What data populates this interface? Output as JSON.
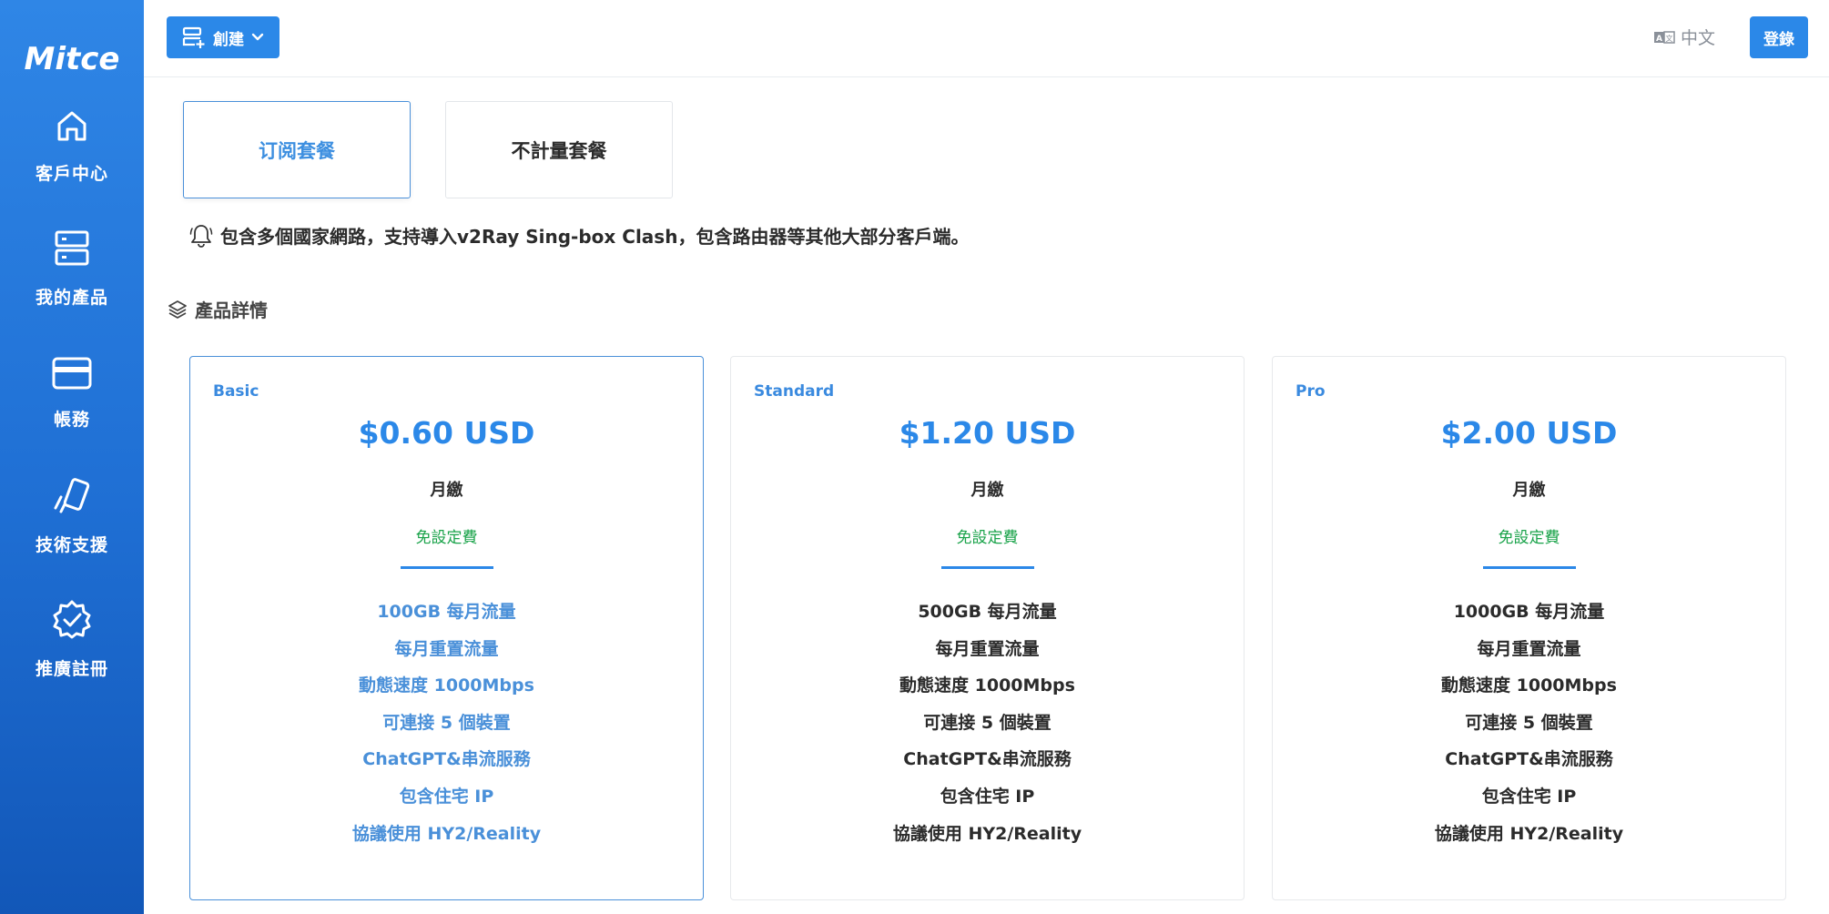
{
  "brand": {
    "logo_text": "Mitce"
  },
  "sidebar": {
    "items": [
      {
        "label": "客戶中心",
        "icon": "home-icon"
      },
      {
        "label": "我的產品",
        "icon": "server-icon"
      },
      {
        "label": "帳務",
        "icon": "credit-card-icon"
      },
      {
        "label": "技術支援",
        "icon": "support-card-icon"
      },
      {
        "label": "推廣註冊",
        "icon": "badge-check-icon"
      }
    ]
  },
  "header": {
    "create_label": "創建",
    "language_label": "中文",
    "login_label": "登錄"
  },
  "tabs": [
    {
      "label": "订阅套餐",
      "active": true
    },
    {
      "label": "不計量套餐",
      "active": false
    }
  ],
  "notice": "包含多個國家網路，支持導入v2Ray Sing-box Clash，包含路由器等其他大部分客戶端。",
  "section_title": "產品詳情",
  "plans": [
    {
      "name": "Basic",
      "price": "$0.60 USD",
      "cycle": "月繳",
      "setup": "免設定費",
      "features": [
        "100GB 每月流量",
        "每月重置流量",
        "動態速度 1000Mbps",
        "可連接 5 個裝置",
        "ChatGPT&串流服務",
        "包含住宅 IP",
        "協議使用 HY2/Reality"
      ],
      "selected": true
    },
    {
      "name": "Standard",
      "price": "$1.20 USD",
      "cycle": "月繳",
      "setup": "免設定費",
      "features": [
        "500GB 每月流量",
        "每月重置流量",
        "動態速度 1000Mbps",
        "可連接 5 個裝置",
        "ChatGPT&串流服務",
        "包含住宅 IP",
        "協議使用 HY2/Reality"
      ],
      "selected": false
    },
    {
      "name": "Pro",
      "price": "$2.00 USD",
      "cycle": "月繳",
      "setup": "免設定費",
      "features": [
        "1000GB 每月流量",
        "每月重置流量",
        "動態速度 1000Mbps",
        "可連接 5 個裝置",
        "ChatGPT&串流服務",
        "包含住宅 IP",
        "協議使用 HY2/Reality"
      ],
      "selected": false
    }
  ],
  "colors": {
    "primary": "#2b88e8",
    "sidebar_top": "#2f86e6",
    "sidebar_bottom": "#1257b8",
    "setup_green": "#1aa34a"
  }
}
